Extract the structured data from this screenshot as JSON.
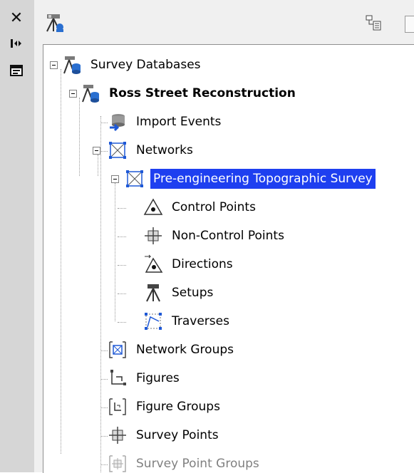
{
  "side_bar": {
    "close_glyph": "✕",
    "icons": [
      "close-icon",
      "auto-hide-icon",
      "properties-icon"
    ]
  },
  "toolbar": {
    "left_icon": "survey-toolspace-icon",
    "right_icon": "tree-view-icon"
  },
  "tree": {
    "root": "Survey Databases",
    "database": "Ross Street Reconstruction",
    "import_events": "Import Events",
    "networks": "Networks",
    "network": "Pre-engineering Topographic Survey",
    "control_points": "Control Points",
    "non_control_points": "Non-Control Points",
    "directions": "Directions",
    "setups": "Setups",
    "traverses": "Traverses",
    "network_groups": "Network Groups",
    "figures": "Figures",
    "figure_groups": "Figure Groups",
    "survey_points": "Survey Points",
    "survey_point_groups": "Survey Point Groups"
  },
  "colors": {
    "selection": "#1e3ff0",
    "panel_bg": "#f0f0f0",
    "side_bar_bg": "#d6d6d6"
  }
}
